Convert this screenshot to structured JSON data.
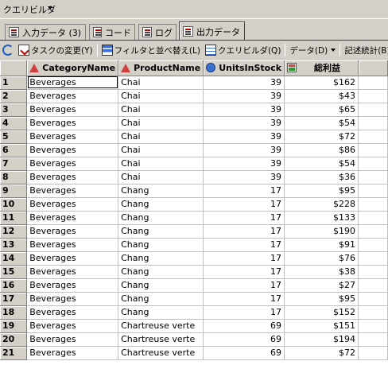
{
  "titlebar": {
    "title": "クエリビルダ"
  },
  "tabs": [
    {
      "label": "入力データ (3)",
      "icon": "input-data-icon"
    },
    {
      "label": "コード",
      "icon": "code-icon"
    },
    {
      "label": "ログ",
      "icon": "log-icon"
    },
    {
      "label": "出力データ",
      "icon": "output-data-icon",
      "active": true
    }
  ],
  "toolbar": {
    "task_change": "タスクの変更(Y)",
    "filter_sort": "フィルタと並べ替え(L)",
    "query_builder": "クエリビルダ(Q)",
    "data": "データ(D)",
    "stats": "記述統計(B)"
  },
  "columns": [
    {
      "label": "CategoryName",
      "type_icon": "character-type-icon"
    },
    {
      "label": "ProductName",
      "type_icon": "character-type-icon"
    },
    {
      "label": "UnitsInStock",
      "type_icon": "numeric-type-icon"
    },
    {
      "label": "総利益",
      "type_icon": "currency-type-icon"
    }
  ],
  "rows": [
    [
      "1",
      "Beverages",
      "Chai",
      "39",
      "$162"
    ],
    [
      "2",
      "Beverages",
      "Chai",
      "39",
      "$43"
    ],
    [
      "3",
      "Beverages",
      "Chai",
      "39",
      "$65"
    ],
    [
      "4",
      "Beverages",
      "Chai",
      "39",
      "$54"
    ],
    [
      "5",
      "Beverages",
      "Chai",
      "39",
      "$72"
    ],
    [
      "6",
      "Beverages",
      "Chai",
      "39",
      "$86"
    ],
    [
      "7",
      "Beverages",
      "Chai",
      "39",
      "$54"
    ],
    [
      "8",
      "Beverages",
      "Chai",
      "39",
      "$36"
    ],
    [
      "9",
      "Beverages",
      "Chang",
      "17",
      "$95"
    ],
    [
      "10",
      "Beverages",
      "Chang",
      "17",
      "$228"
    ],
    [
      "11",
      "Beverages",
      "Chang",
      "17",
      "$133"
    ],
    [
      "12",
      "Beverages",
      "Chang",
      "17",
      "$190"
    ],
    [
      "13",
      "Beverages",
      "Chang",
      "17",
      "$91"
    ],
    [
      "14",
      "Beverages",
      "Chang",
      "17",
      "$76"
    ],
    [
      "15",
      "Beverages",
      "Chang",
      "17",
      "$38"
    ],
    [
      "16",
      "Beverages",
      "Chang",
      "17",
      "$27"
    ],
    [
      "17",
      "Beverages",
      "Chang",
      "17",
      "$95"
    ],
    [
      "18",
      "Beverages",
      "Chang",
      "17",
      "$152"
    ],
    [
      "19",
      "Beverages",
      "Chartreuse verte",
      "69",
      "$151"
    ],
    [
      "20",
      "Beverages",
      "Chartreuse verte",
      "69",
      "$194"
    ],
    [
      "21",
      "Beverages",
      "Chartreuse verte",
      "69",
      "$72"
    ]
  ]
}
